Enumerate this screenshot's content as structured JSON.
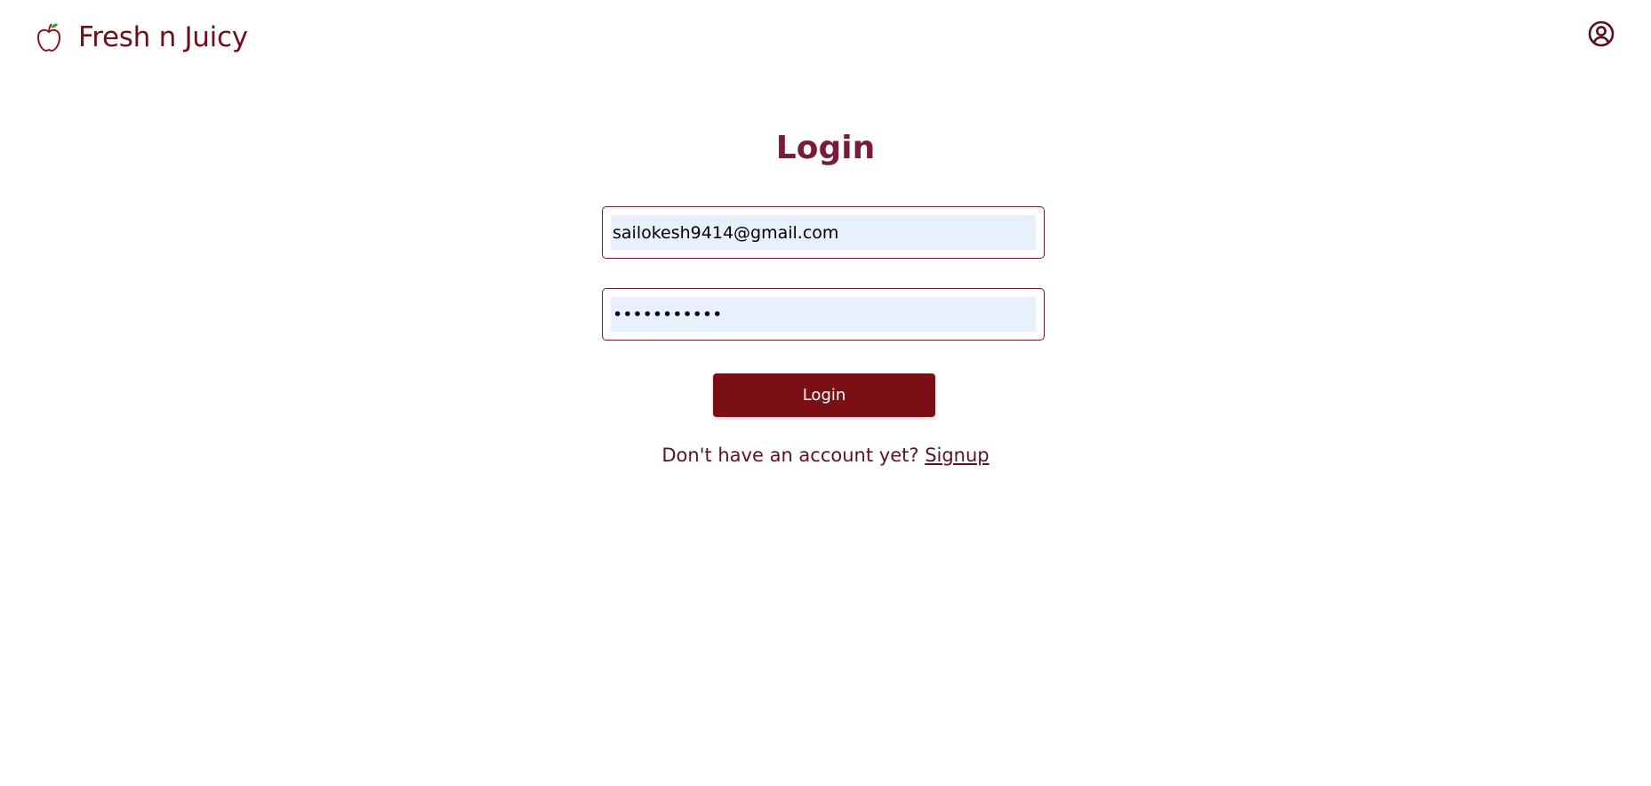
{
  "header": {
    "brand_name": "Fresh n Juicy",
    "brand_icon": "apple-icon",
    "account_icon": "user-circle-icon"
  },
  "login": {
    "title": "Login",
    "email_value": "sailokesh9414@gmail.com",
    "password_value": "•••••••••••",
    "submit_label": "Login",
    "signup_prompt": "Don't have an account yet?",
    "signup_link": "Signup"
  },
  "colors": {
    "brand": "#6e0f1a",
    "title": "#7a1a3c",
    "button": "#7a1015",
    "autofill": "#e8f0fe"
  }
}
